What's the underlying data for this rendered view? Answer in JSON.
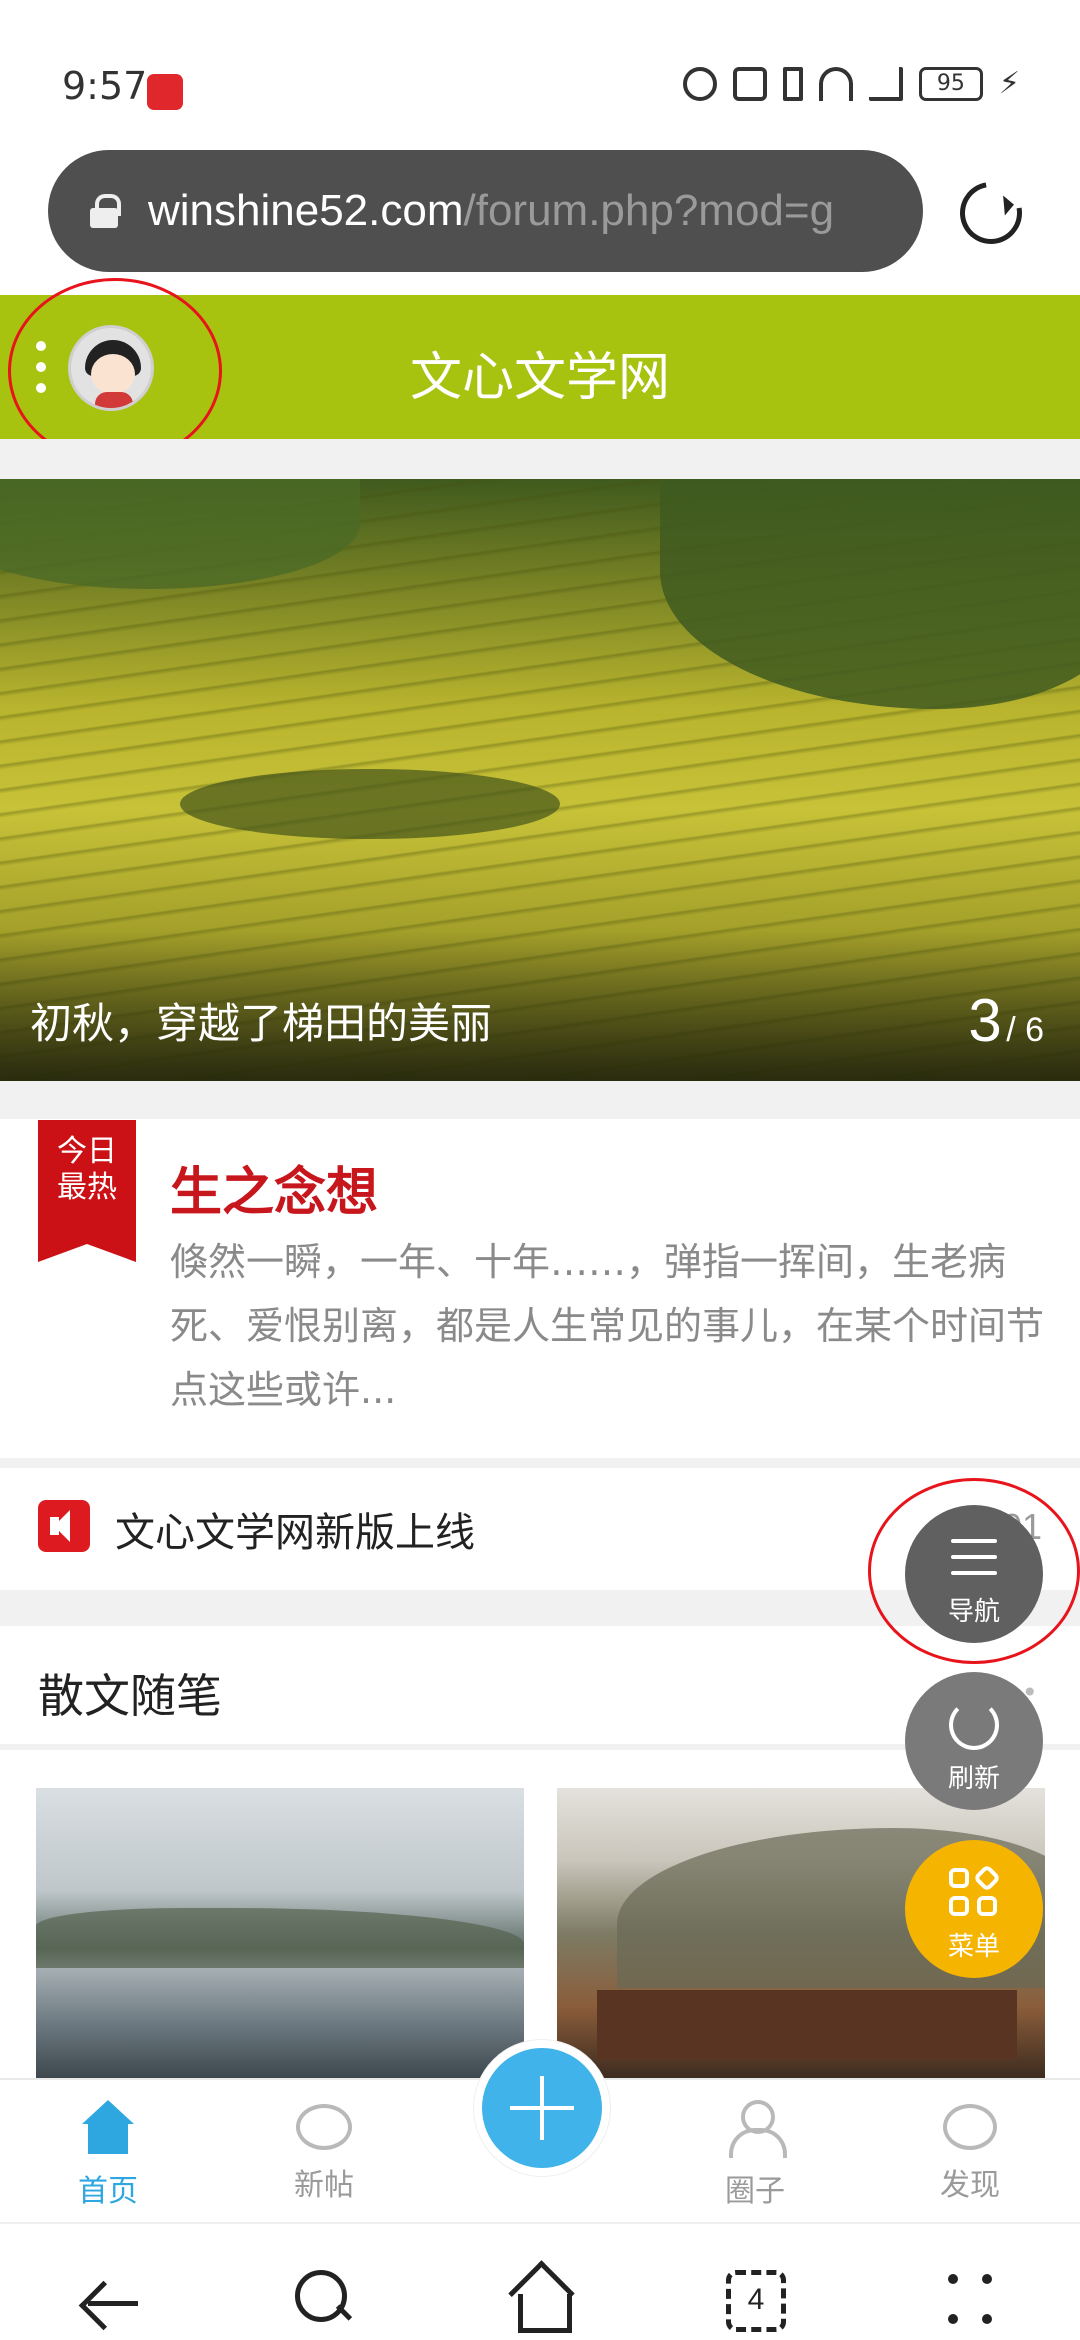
{
  "status_bar": {
    "time": "9:57",
    "battery": "95"
  },
  "browser": {
    "url_host": "winshine52.com",
    "url_path": "/forum.php?mod=g"
  },
  "header": {
    "site_title": "文心文学网"
  },
  "banner": {
    "caption": "初秋，穿越了梯田的美丽",
    "current": "3",
    "total": "/ 6"
  },
  "hot_article": {
    "badge_line1": "今日",
    "badge_line2": "最热",
    "title": "生之念想",
    "summary": "倏然一瞬，一年、十年……，弹指一挥间，生老病死、爱恨别离，都是人生常见的事儿，在某个时间节点这些或许..."
  },
  "notice": {
    "text": "文心文学网新版上线",
    "date": "03-01"
  },
  "section": {
    "title": "散文随笔",
    "more": "•••"
  },
  "floating": {
    "nav": "导航",
    "refresh": "刷新",
    "menu": "菜单"
  },
  "bottom_nav": {
    "home": "首页",
    "new_posts": "新帖",
    "circles": "圈子",
    "discover": "发现"
  },
  "system_nav": {
    "tab_count": "4"
  },
  "colors": {
    "header_bg": "#a7c30f",
    "accent_blue": "#3fb3ea",
    "hot_red": "#cc1116",
    "menu_yellow": "#f5b400"
  }
}
